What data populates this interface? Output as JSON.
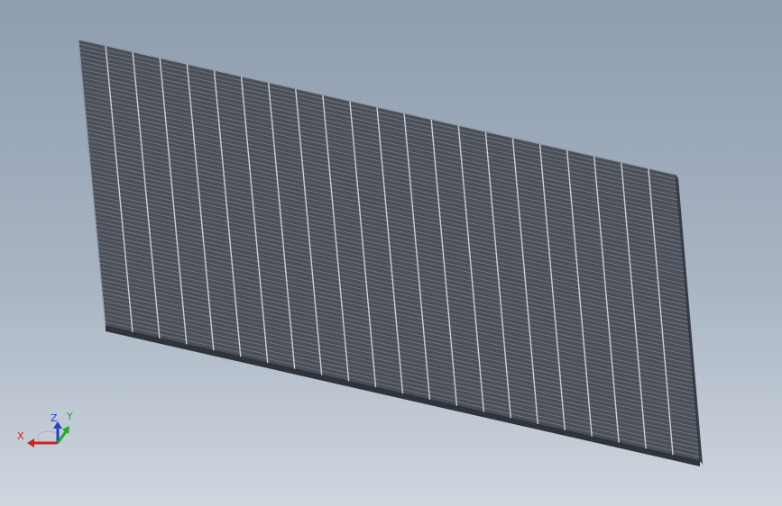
{
  "viewport": {
    "background_top": "#8f9db0",
    "background_bottom": "#cfd6de"
  },
  "model": {
    "name": "grating panel",
    "face_color": "#4a4f58",
    "edge_color": "#2f333a",
    "bar_color": "#c9ced6",
    "crossbar_color": "#767c86",
    "bearing_bar_count": 22,
    "cross_bar_count": 68
  },
  "triad": {
    "x_label": "X",
    "y_label": "Y",
    "z_label": "Z",
    "x_color": "#cc2222",
    "y_color": "#22aa22",
    "z_color": "#2244cc"
  }
}
